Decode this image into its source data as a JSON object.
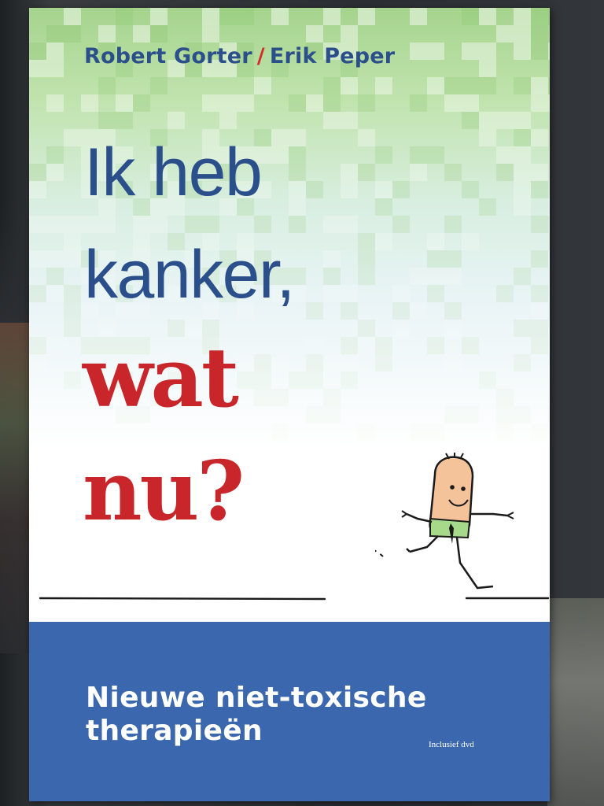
{
  "cover": {
    "authors": {
      "first": "Robert Gorter",
      "separator": "/",
      "second": "Erik Peper"
    },
    "title_line_1": "Ik heb",
    "title_line_2": "kanker,",
    "title_line_3": "wat",
    "title_line_4": "nu?",
    "subtitle_line_1": "Nieuwe niet-toxische",
    "subtitle_line_2": "therapieën",
    "extra_label": "Inclusief dvd",
    "illustration": "cartoon-man-jumping-over-water-gap"
  },
  "colors": {
    "author_blue": "#2a4f8a",
    "title_red": "#c8262b",
    "sea_blue": "#3b67ae",
    "pixel_green": "#a5d48d"
  }
}
